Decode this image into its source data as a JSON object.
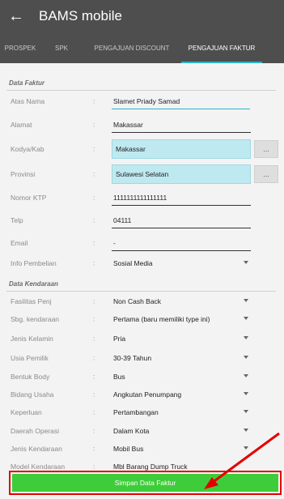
{
  "app": {
    "title": "BAMS mobile"
  },
  "tabs": [
    {
      "label": "PROSPEK",
      "active": false
    },
    {
      "label": "SPK",
      "active": false
    },
    {
      "label": "PENGAJUAN DISCOUNT",
      "active": false
    },
    {
      "label": "PENGAJUAN FAKTUR",
      "active": true
    }
  ],
  "faktur": {
    "section_title": "Data Faktur",
    "atas_nama": {
      "label": "Atas Nama",
      "value": "Slamet Priady Samad"
    },
    "alamat": {
      "label": "Alamat",
      "value": "Makassar"
    },
    "kodya": {
      "label": "Kodya/Kab",
      "value": "Makassar",
      "button": "..."
    },
    "provinsi": {
      "label": "Provinsi",
      "value": "Sulawesi Selatan",
      "button": "..."
    },
    "ktp": {
      "label": "Nomor KTP",
      "value": "1111111111111111"
    },
    "telp": {
      "label": "Telp",
      "value": "04111"
    },
    "email": {
      "label": "Email",
      "value": "-"
    },
    "info": {
      "label": "Info Pembelian",
      "value": "Sosial Media"
    }
  },
  "kendaraan": {
    "section_title": "Data Kendaraan",
    "fasilitas": {
      "label": "Fasilitas Penj",
      "value": "Non Cash Back"
    },
    "sbg": {
      "label": "Sbg. kendaraan",
      "value": "Pertama (baru memiliki type ini)"
    },
    "kelamin": {
      "label": "Jenis Kelamin",
      "value": "Pria"
    },
    "usia": {
      "label": "Usia Pemilik",
      "value": "30-39 Tahun"
    },
    "body": {
      "label": "Bentuk Body",
      "value": "Bus"
    },
    "usaha": {
      "label": "Bidang Usaha",
      "value": "Angkutan Penumpang"
    },
    "keperluan": {
      "label": "Keperluan",
      "value": "Pertambangan"
    },
    "daerah": {
      "label": "Daerah Operasi",
      "value": "Dalam Kota"
    },
    "jenis": {
      "label": "Jenis Kendaraan",
      "value": "Mobil Bus"
    },
    "model": {
      "label": "Model Kendaraan",
      "value": "Mbl Barang Dump Truck"
    }
  },
  "colon": ":",
  "save_button": "Simpan Data Faktur",
  "colors": {
    "appbar": "#4e4e4e",
    "accent": "#29b6c9",
    "save": "#3fcc3a",
    "annotation": "#e30000"
  },
  "icons": {
    "back": "arrow-left-icon",
    "dropdown": "triangle-down-icon"
  }
}
